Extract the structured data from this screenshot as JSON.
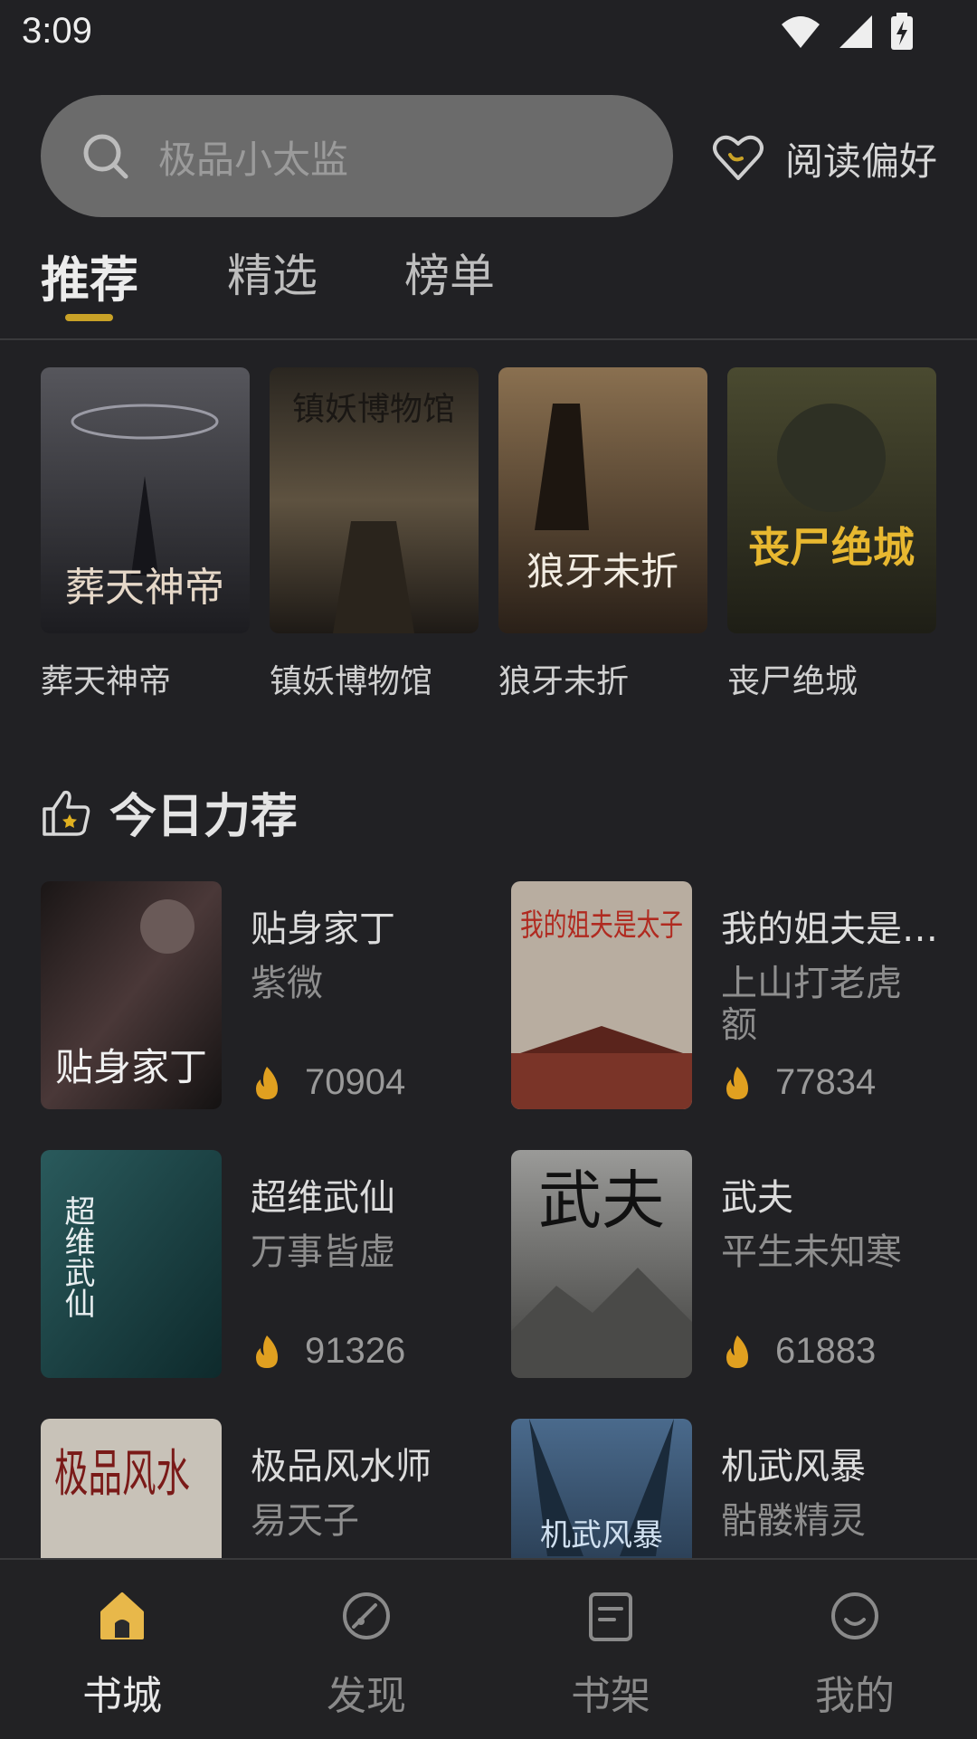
{
  "status_bar": {
    "time": "3:09"
  },
  "search": {
    "placeholder": "极品小太监"
  },
  "preference": {
    "label": "阅读偏好"
  },
  "tabs": [
    {
      "label": "推荐"
    },
    {
      "label": "精选"
    },
    {
      "label": "榜单"
    }
  ],
  "top_books": [
    {
      "title": "葬天神帝",
      "cover_text": "葬天神帝",
      "cover_color": "#3a3a3e"
    },
    {
      "title": "镇妖博物馆",
      "cover_text": "镇妖博物馆",
      "cover_color": "#3b3326"
    },
    {
      "title": "狼牙未折",
      "cover_text": "狼牙未折",
      "cover_color": "#4a3b2a"
    },
    {
      "title": "丧尸绝城",
      "cover_text": "丧尸绝城",
      "cover_color": "#3c3b25"
    }
  ],
  "section": {
    "title": "今日力荐"
  },
  "recommendations": [
    {
      "title": "贴身家丁",
      "author": "紫微",
      "score": "70904",
      "cover_text": "贴身家丁",
      "cover_color": "#2c2424"
    },
    {
      "title": "我的姐夫是太子",
      "author": "上山打老虎额",
      "score": "77834",
      "cover_text": "我的姐夫是太子",
      "cover_color": "#8a7f73"
    },
    {
      "title": "超维武仙",
      "author": "万事皆虚",
      "score": "91326",
      "cover_text": "超维武仙",
      "cover_color": "#1e4a4c"
    },
    {
      "title": "武夫",
      "author": "平生未知寒",
      "score": "61883",
      "cover_text": "武夫",
      "cover_color": "#6e6e6c"
    },
    {
      "title": "极品风水师",
      "author": "易天子",
      "score": "",
      "cover_text": "极品风水",
      "cover_color": "#7e7a72"
    },
    {
      "title": "机武风暴",
      "author": "骷髅精灵",
      "score": "",
      "cover_text": "机武风暴",
      "cover_color": "#2e3d50"
    }
  ],
  "bottom_nav": [
    {
      "label": "书城",
      "icon": "home-icon",
      "active": true
    },
    {
      "label": "发现",
      "icon": "discover-icon",
      "active": false
    },
    {
      "label": "书架",
      "icon": "bookshelf-icon",
      "active": false
    },
    {
      "label": "我的",
      "icon": "profile-icon",
      "active": false
    }
  ],
  "colors": {
    "accent": "#c9a227",
    "background": "#212124",
    "search_bg": "#6b6b6b"
  }
}
